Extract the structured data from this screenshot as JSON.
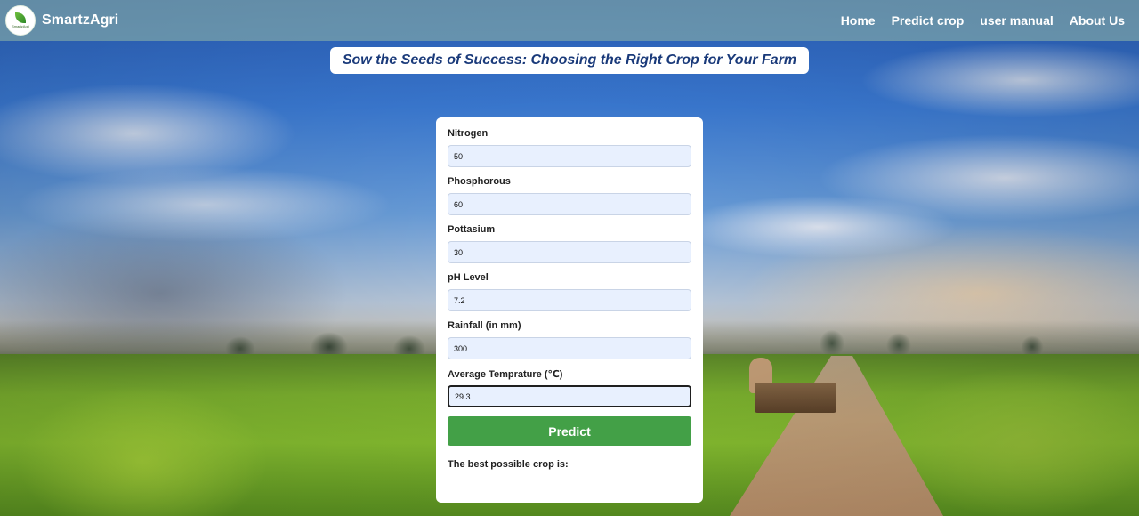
{
  "brand": {
    "name": "SmartzAgri",
    "logo_text": "SmartzAgri"
  },
  "nav": {
    "links": [
      {
        "label": "Home"
      },
      {
        "label": "Predict crop"
      },
      {
        "label": "user manual"
      },
      {
        "label": "About Us"
      }
    ]
  },
  "banner": {
    "text": "Sow the Seeds of Success: Choosing the Right Crop for Your Farm"
  },
  "form": {
    "fields": [
      {
        "label": "Nitrogen",
        "value": "50"
      },
      {
        "label": "Phosphorous",
        "value": "60"
      },
      {
        "label": "Pottasium",
        "value": "30"
      },
      {
        "label": "pH Level",
        "value": "7.2"
      },
      {
        "label": "Rainfall (in mm)",
        "value": "300"
      },
      {
        "label": "Average Temprature (℃)",
        "value": "29.3"
      }
    ],
    "submit_label": "Predict",
    "result_text": "The best possible crop is:"
  },
  "colors": {
    "primary_button": "#43a047",
    "input_bg": "#e8f0fe",
    "banner_text": "#1a3a7a"
  }
}
